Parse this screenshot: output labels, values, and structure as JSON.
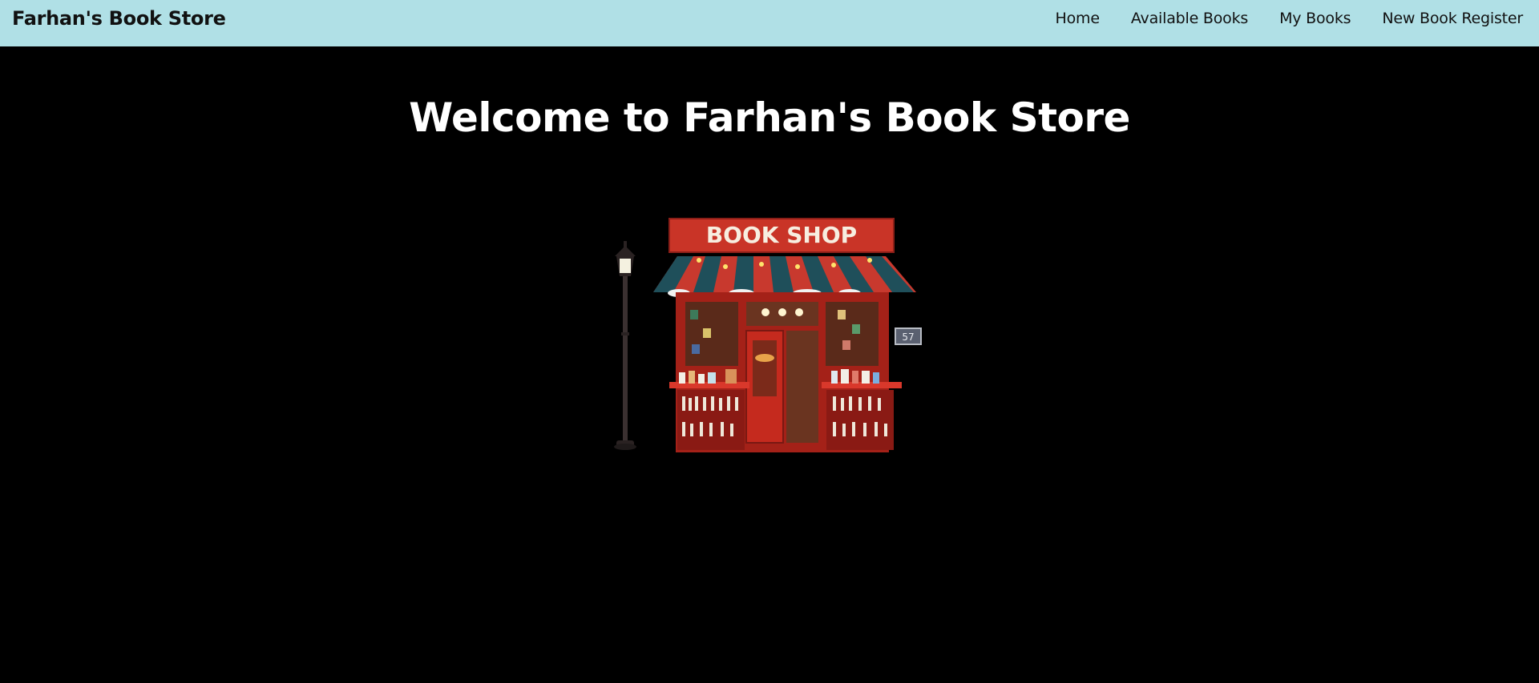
{
  "navbar": {
    "brand": "Farhan's Book Store",
    "links": [
      {
        "label": "Home"
      },
      {
        "label": "Available Books"
      },
      {
        "label": "My Books"
      },
      {
        "label": "New Book Register"
      }
    ],
    "background_color": "#b0e0e6"
  },
  "hero": {
    "title": "Welcome to Farhan's Book Store"
  },
  "illustration": {
    "sign_text": "BOOK SHOP",
    "house_number": "57",
    "icon": "book-shop-storefront-image"
  },
  "colors": {
    "page_background": "#000000",
    "title_color": "#ffffff"
  }
}
